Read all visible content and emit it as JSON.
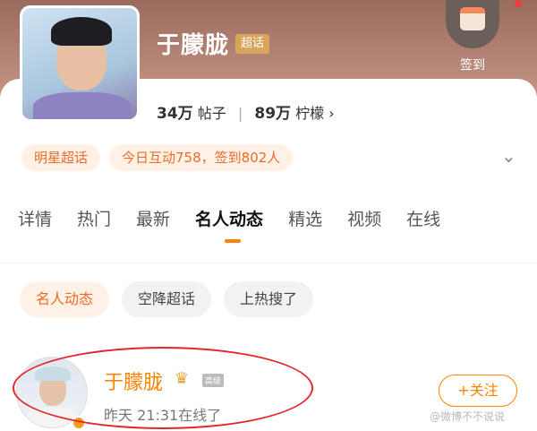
{
  "profile": {
    "name": "于朦胧",
    "super_badge": "超话",
    "signin_label": "签到",
    "posts_count": "34万",
    "posts_label": "帖子",
    "fans_count": "89万",
    "fans_label": "柠檬",
    "stats_arrow": "›"
  },
  "tags": [
    "明星超话",
    "今日互动758，签到802人"
  ],
  "tabs": [
    "详情",
    "热门",
    "最新",
    "名人动态",
    "精选",
    "视频",
    "在线"
  ],
  "active_tab": "名人动态",
  "chips": [
    "名人动态",
    "空降超话",
    "上热搜了"
  ],
  "post": {
    "author": "于朦胧",
    "level": "高级",
    "time": "昨天 21:31在线了",
    "follow_label": "+关注",
    "watermark": "@微博不不说说"
  },
  "colors": {
    "accent": "#ff8200",
    "highlight": "#e2262c"
  },
  "icons": {
    "signin": "calendar-icon",
    "expand": "chevron-down-icon",
    "crown": "crown-icon"
  }
}
